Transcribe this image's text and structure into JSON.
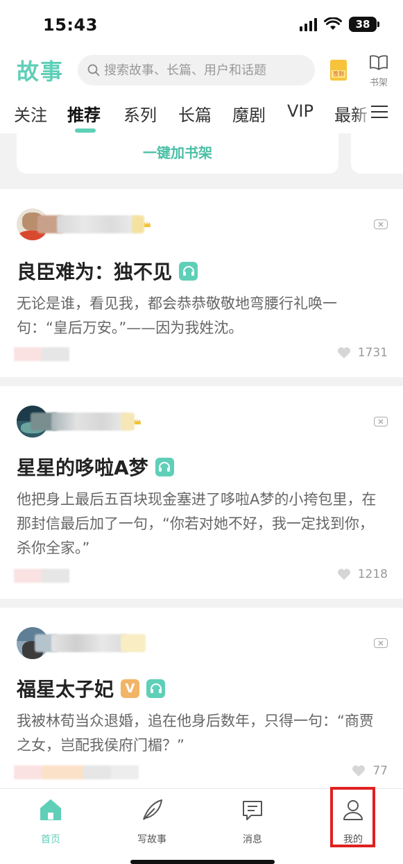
{
  "status_bar": {
    "time": "15:43",
    "battery": "38"
  },
  "header": {
    "logo": "故事",
    "search_placeholder": "搜索故事、长篇、用户和话题",
    "signin_label": "签到",
    "bookshelf_label": "书架"
  },
  "tabs": [
    {
      "label": "关注"
    },
    {
      "label": "推荐"
    },
    {
      "label": "系列"
    },
    {
      "label": "长篇"
    },
    {
      "label": "魔剧"
    },
    {
      "label": "VIP"
    },
    {
      "label": "最新"
    }
  ],
  "shelf": {
    "add_button": "一键加书架"
  },
  "stories": [
    {
      "title": "良臣难为：独不见",
      "badges": [
        "audio-icon"
      ],
      "excerpt": "无论是谁，看见我，都会恭恭敬敬地弯腰行礼唤一句：“皇后万安。”——因为我姓沈。",
      "likes": "1731"
    },
    {
      "title": "星星的哆啦A梦",
      "badges": [
        "audio-icon"
      ],
      "excerpt": "他把身上最后五百块现金塞进了哆啦A梦的小挎包里，在那封信最后加了一句，“你若对她不好，我一定找到你，杀你全家。”",
      "likes": "1218"
    },
    {
      "title": "福星太子妃",
      "badges": [
        "vip-badge",
        "audio-icon"
      ],
      "vip_label": "V",
      "excerpt": "我被林荀当众退婚，追在他身后数年，只得一句：“商贾之女，岂配我侯府门楣？”",
      "likes": "77"
    }
  ],
  "tabbar": [
    {
      "label": "首页"
    },
    {
      "label": "写故事"
    },
    {
      "label": "消息"
    },
    {
      "label": "我的"
    }
  ],
  "colors": {
    "accent": "#5fcfb8",
    "highlight": "#e02020",
    "vip": "#f2b466"
  }
}
